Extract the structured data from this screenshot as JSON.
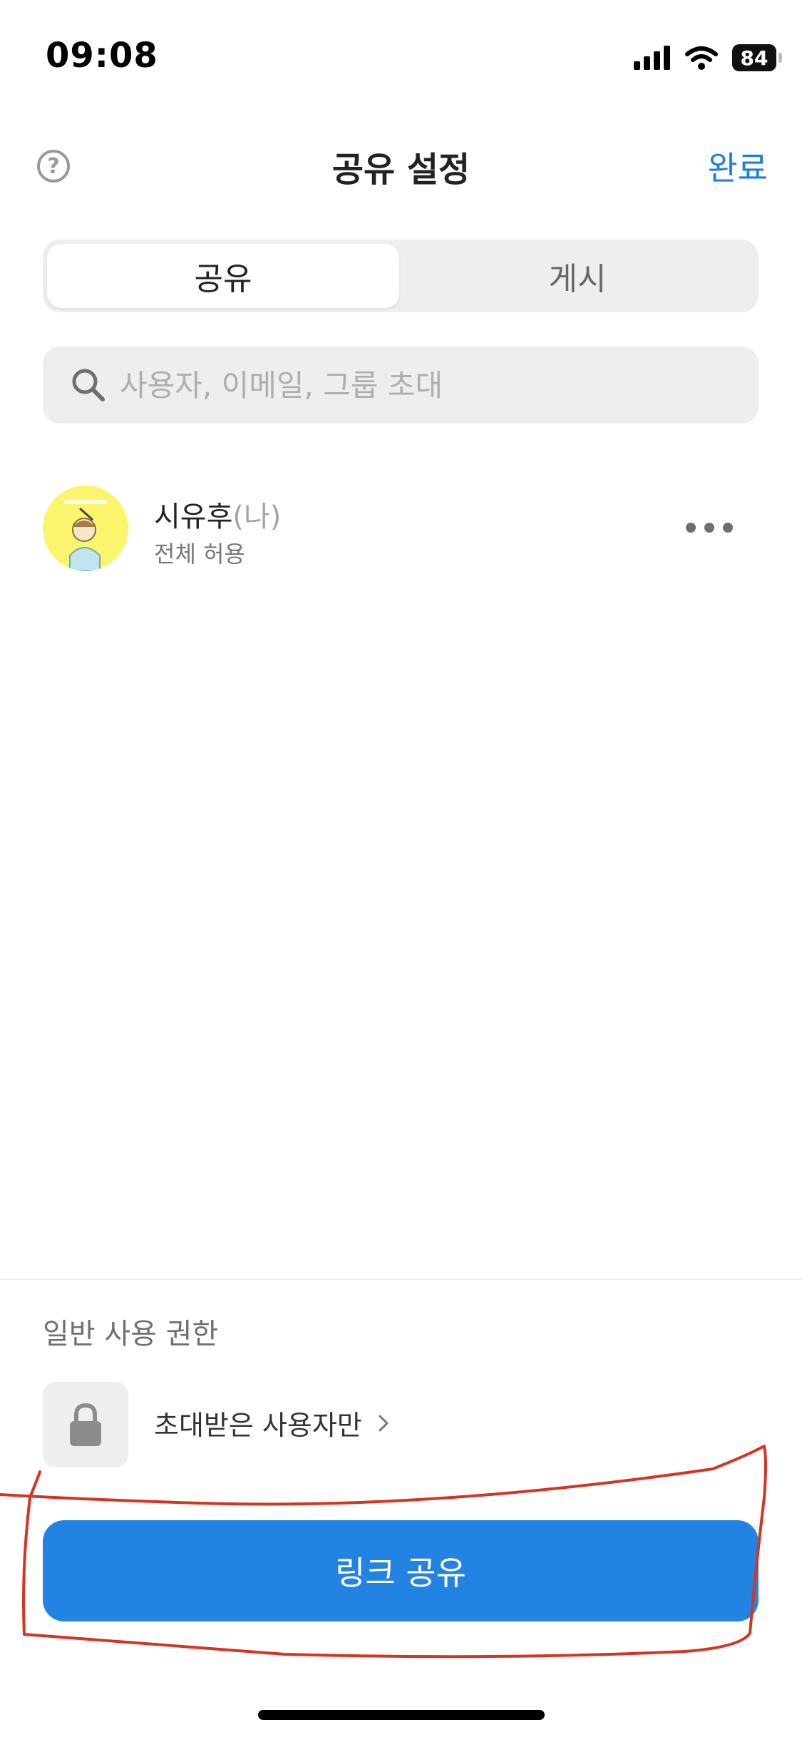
{
  "status_bar": {
    "time": "09:08",
    "battery": "84"
  },
  "header": {
    "title": "공유 설정",
    "done_label": "완료",
    "help_glyph": "?"
  },
  "tabs": [
    {
      "label": "공유",
      "active": true
    },
    {
      "label": "게시",
      "active": false
    }
  ],
  "search": {
    "placeholder": "사용자, 이메일, 그룹 초대",
    "value": ""
  },
  "members": [
    {
      "name": "시유후",
      "suffix": "(나)",
      "permission": "전체 허용"
    }
  ],
  "general_access": {
    "title": "일반 사용 권한",
    "value": "초대받은 사용자만"
  },
  "share_link_label": "링크 공유",
  "colors": {
    "accent": "#2383e2",
    "done_text": "#1e7fe0",
    "avatar_bg": "#fbf56e",
    "annotation": "#d63423"
  },
  "icons": [
    "help-icon",
    "search-icon",
    "more-icon",
    "lock-icon",
    "chevron-right-icon",
    "signal-icon",
    "wifi-icon",
    "battery-icon"
  ]
}
